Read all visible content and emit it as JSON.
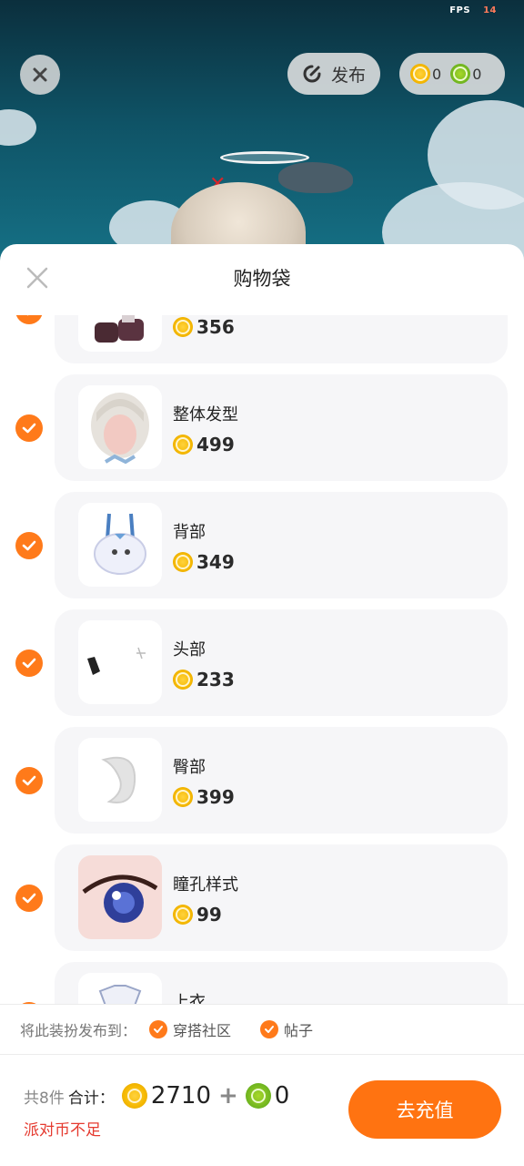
{
  "status": {
    "fps_label": "FPS",
    "fps_value": "14"
  },
  "topbar": {
    "publish_label": "发布",
    "gold_count": "0",
    "green_count": "0"
  },
  "sheet": {
    "title": "购物袋",
    "items": [
      {
        "name": "",
        "price": "356",
        "thumb": "shoes"
      },
      {
        "name": "整体发型",
        "price": "499",
        "thumb": "hair"
      },
      {
        "name": "背部",
        "price": "349",
        "thumb": "backpack"
      },
      {
        "name": "头部",
        "price": "233",
        "thumb": "head-accessory"
      },
      {
        "name": "臀部",
        "price": "399",
        "thumb": "tail"
      },
      {
        "name": "瞳孔样式",
        "price": "99",
        "thumb": "eye"
      },
      {
        "name": "上衣",
        "price": "",
        "thumb": "top"
      }
    ]
  },
  "publish": {
    "label": "将此装扮发布到：",
    "options": [
      "穿搭社区",
      "帖子"
    ]
  },
  "footer": {
    "count_text": "共8件",
    "total_label": "合计：",
    "gold_total": "2710",
    "green_total": "0",
    "warning": "派对币不足",
    "recharge_label": "去充值"
  },
  "colors": {
    "accent": "#ff7311",
    "warning": "#e53a2f",
    "check": "#ff7a1a"
  }
}
